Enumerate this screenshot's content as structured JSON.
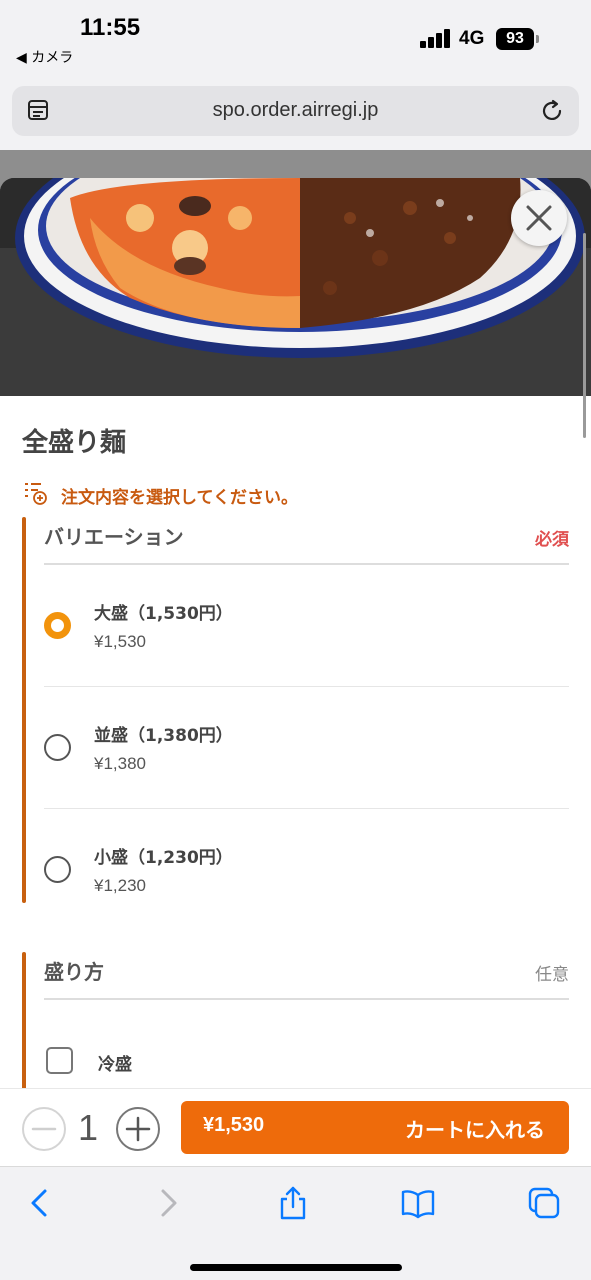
{
  "status": {
    "time": "11:55",
    "back_app": "◀ カメラ",
    "network": "4G",
    "battery": "93"
  },
  "browser": {
    "url": "spo.order.airregi.jp"
  },
  "item": {
    "title": "全盛り麺",
    "hint": "注文内容を選択してください。"
  },
  "variation": {
    "title": "バリエーション",
    "badge": "必須",
    "options": [
      {
        "name": "大盛（1,530円）",
        "price": "¥1,530",
        "selected": true
      },
      {
        "name": "並盛（1,380円）",
        "price": "¥1,380",
        "selected": false
      },
      {
        "name": "小盛（1,230円）",
        "price": "¥1,230",
        "selected": false
      }
    ]
  },
  "serving": {
    "title": "盛り方",
    "badge": "任意",
    "options": [
      {
        "name": "冷盛",
        "checked": false
      }
    ]
  },
  "cart": {
    "quantity": "1",
    "price": "¥1,530",
    "label": "カートに入れる"
  },
  "colors": {
    "accent": "#ee6b0b",
    "section_bar": "#c8600f",
    "required": "#e05050",
    "radio_selected": "#f2930c",
    "ios_blue": "#0a7aff"
  },
  "icons": [
    "tabs-icon",
    "reload-icon",
    "close-icon",
    "list-add-icon",
    "minus-icon",
    "plus-icon",
    "back-icon",
    "forward-icon",
    "share-icon",
    "bookmarks-icon",
    "tabs-overview-icon"
  ]
}
